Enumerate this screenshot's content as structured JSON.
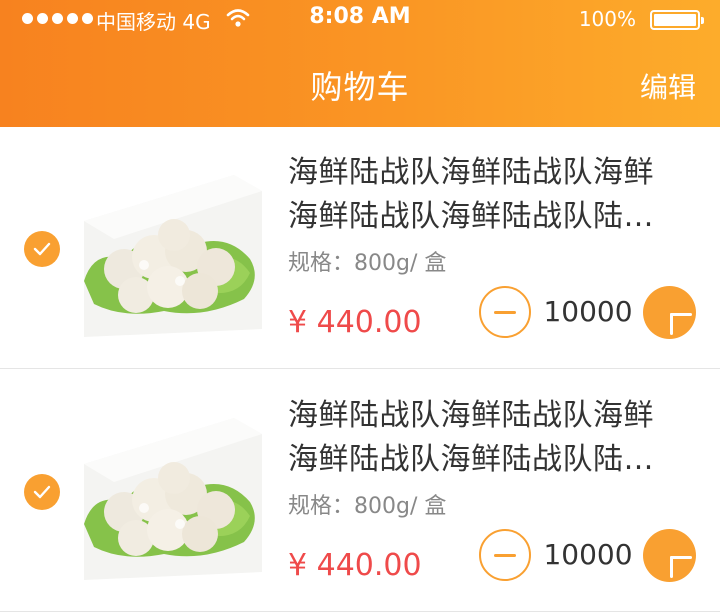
{
  "status_bar": {
    "carrier": "中国移动 4G",
    "time": "8:08 AM",
    "battery": "100%"
  },
  "nav": {
    "title": "购物车",
    "edit_label": "编辑"
  },
  "cart_items": [
    {
      "title_line1": "海鲜陆战队海鲜陆战队海鲜",
      "title_line2": "海鲜陆战队海鲜陆战队陆…",
      "spec": "规格：800g/ 盒",
      "price": "¥ 440.00",
      "quantity": "10000",
      "checked": true
    },
    {
      "title_line1": "海鲜陆战队海鲜陆战队海鲜",
      "title_line2": "海鲜陆战队海鲜陆战队陆…",
      "spec": "规格：800g/ 盒",
      "price": "¥ 440.00",
      "quantity": "10000",
      "checked": true
    }
  ],
  "colors": {
    "accent": "#f9a031",
    "header_start": "#f7821f",
    "header_end": "#fdac2b",
    "price": "#ef4a4a"
  }
}
